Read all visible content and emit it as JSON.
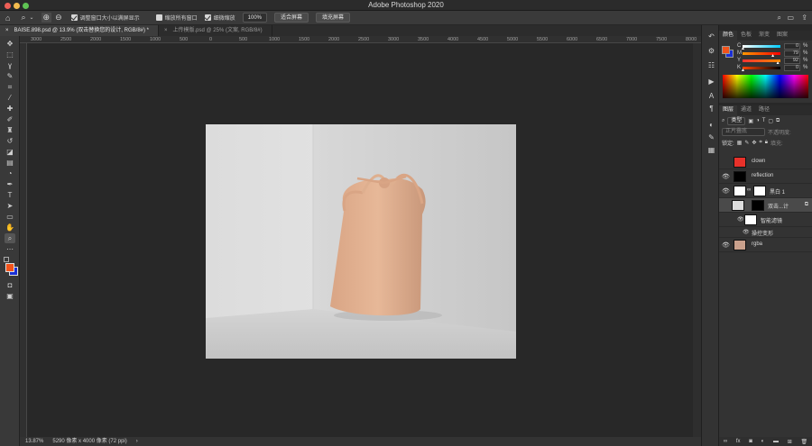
{
  "app": {
    "title": "Adobe Photoshop 2020"
  },
  "options_bar": {
    "resize_windows_label": "调整窗口大小以满屏显示",
    "zoom_all_windows_label": "缩放所有窗口",
    "scrubby_zoom_label": "细微缩放",
    "zoom_value": "100%",
    "fit_screen_label": "适合屏幕",
    "fill_screen_label": "填充屏幕"
  },
  "documents": [
    {
      "name": "BAISE.898.psd @ 13.9% (双击替换您的设计, RGB/8#) *",
      "active": true
    },
    {
      "name": "上传模版.psd @ 25% (文案, RGB/8#)",
      "active": false
    }
  ],
  "ruler": {
    "labels": [
      "3000",
      "2500",
      "2000",
      "1500",
      "1000",
      "500",
      "0",
      "500",
      "1000",
      "1500",
      "2000",
      "2500",
      "3000",
      "3500",
      "4000",
      "4500",
      "5000",
      "5500",
      "6000",
      "6500",
      "7000",
      "7500",
      "8000"
    ]
  },
  "status": {
    "zoom": "13.87%",
    "doc_info": "5290 像素 x 4000 像素 (72 ppi)"
  },
  "color_panel": {
    "tabs": [
      "颜色",
      "色板",
      "渐变",
      "图案"
    ],
    "channels": [
      {
        "name": "C",
        "value": "0",
        "unit": "%"
      },
      {
        "name": "M",
        "value": "79",
        "unit": "%"
      },
      {
        "name": "Y",
        "value": "92",
        "unit": "%"
      },
      {
        "name": "K",
        "value": "0",
        "unit": "%"
      }
    ],
    "foreground": "#f2531b",
    "background": "#1a2fd6"
  },
  "layers_panel": {
    "tabs": [
      "图层",
      "通道",
      "路径"
    ],
    "kind_label": "类型",
    "blend_mode": "正片叠底",
    "opacity_label": "不透明度:",
    "lock_label": "锁定:",
    "fill_label": "填充:",
    "layers": [
      {
        "name": "clown",
        "visible": false,
        "thumb": "#e8312a"
      },
      {
        "name": "reflection",
        "visible": true,
        "thumb": "#000000"
      },
      {
        "name": "黑白 1",
        "visible": true,
        "thumb": "#ffffff"
      },
      {
        "name": "双击...计",
        "visible": false,
        "thumb": "#dddddd"
      },
      {
        "name": "智能滤镜",
        "visible": false,
        "thumb": "#ffffff"
      },
      {
        "name": "操控变形",
        "visible": true,
        "thumb": ""
      },
      {
        "name": "rgba",
        "visible": true,
        "thumb": "#c9a08c"
      }
    ]
  }
}
